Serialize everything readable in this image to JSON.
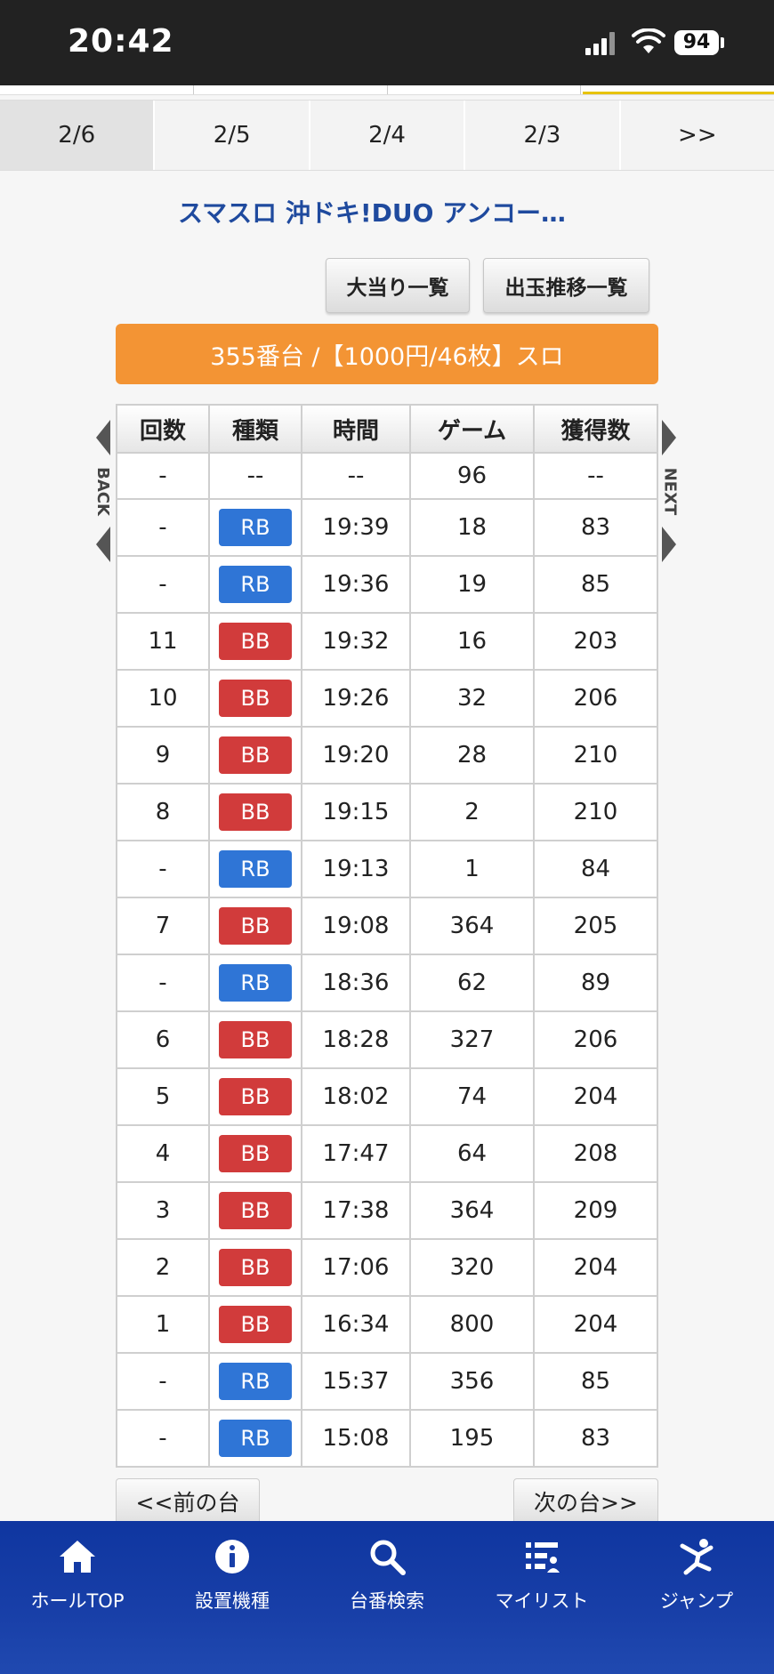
{
  "status_bar": {
    "time": "20:42",
    "battery": "94"
  },
  "date_tabs": [
    {
      "label": "2/6",
      "active": true
    },
    {
      "label": "2/5",
      "active": false
    },
    {
      "label": "2/4",
      "active": false
    },
    {
      "label": "2/3",
      "active": false
    },
    {
      "label": ">>",
      "active": false
    }
  ],
  "machine": {
    "title": "スマスロ 沖ドキ!DUO アンコー…",
    "big_hit_list_label": "大当り一覧",
    "payout_history_label": "出玉推移一覧",
    "banner": "355番台 /【1000円/46枚】スロ"
  },
  "table": {
    "headers": [
      "回数",
      "種類",
      "時間",
      "ゲーム",
      "獲得数"
    ],
    "first_row": {
      "count": "-",
      "kind": "--",
      "time": "--",
      "games": "96",
      "payout": "--"
    },
    "rows": [
      {
        "count": "-",
        "kind": "RB",
        "time": "19:39",
        "games": "18",
        "payout": "83"
      },
      {
        "count": "-",
        "kind": "RB",
        "time": "19:36",
        "games": "19",
        "payout": "85"
      },
      {
        "count": "11",
        "kind": "BB",
        "time": "19:32",
        "games": "16",
        "payout": "203"
      },
      {
        "count": "10",
        "kind": "BB",
        "time": "19:26",
        "games": "32",
        "payout": "206"
      },
      {
        "count": "9",
        "kind": "BB",
        "time": "19:20",
        "games": "28",
        "payout": "210"
      },
      {
        "count": "8",
        "kind": "BB",
        "time": "19:15",
        "games": "2",
        "payout": "210"
      },
      {
        "count": "-",
        "kind": "RB",
        "time": "19:13",
        "games": "1",
        "payout": "84"
      },
      {
        "count": "7",
        "kind": "BB",
        "time": "19:08",
        "games": "364",
        "payout": "205"
      },
      {
        "count": "-",
        "kind": "RB",
        "time": "18:36",
        "games": "62",
        "payout": "89"
      },
      {
        "count": "6",
        "kind": "BB",
        "time": "18:28",
        "games": "327",
        "payout": "206"
      },
      {
        "count": "5",
        "kind": "BB",
        "time": "18:02",
        "games": "74",
        "payout": "204"
      },
      {
        "count": "4",
        "kind": "BB",
        "time": "17:47",
        "games": "64",
        "payout": "208"
      },
      {
        "count": "3",
        "kind": "BB",
        "time": "17:38",
        "games": "364",
        "payout": "209"
      },
      {
        "count": "2",
        "kind": "BB",
        "time": "17:06",
        "games": "320",
        "payout": "204"
      },
      {
        "count": "1",
        "kind": "BB",
        "time": "16:34",
        "games": "800",
        "payout": "204"
      },
      {
        "count": "-",
        "kind": "RB",
        "time": "15:37",
        "games": "356",
        "payout": "85"
      },
      {
        "count": "-",
        "kind": "RB",
        "time": "15:08",
        "games": "195",
        "payout": "83"
      }
    ]
  },
  "side_nav": {
    "back": "BACK",
    "next": "NEXT"
  },
  "pager": {
    "prev": "<<前の台",
    "next": "次の台>>"
  },
  "bottom_nav": [
    {
      "label": "ホールTOP",
      "icon": "home-icon"
    },
    {
      "label": "設置機種",
      "icon": "info-icon"
    },
    {
      "label": "台番検索",
      "icon": "search-icon"
    },
    {
      "label": "マイリスト",
      "icon": "list-icon"
    },
    {
      "label": "ジャンプ",
      "icon": "jump-icon"
    }
  ],
  "colors": {
    "rb": "#2f75d6",
    "bb": "#d13b3b",
    "banner": "#f39434",
    "nav": "#183fa8",
    "title": "#1f4a9e"
  }
}
